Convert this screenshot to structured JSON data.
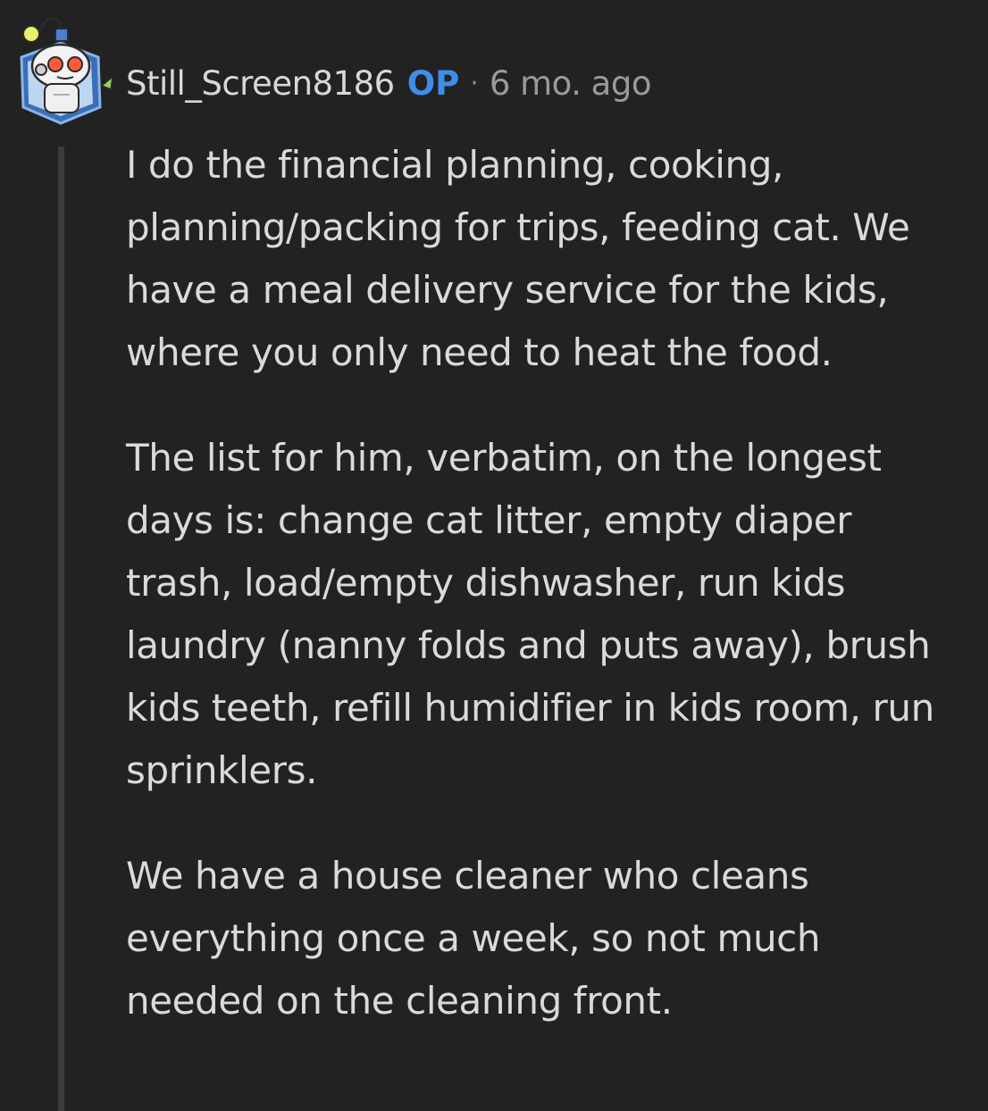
{
  "comment": {
    "author": {
      "username": "Still_Screen8186",
      "badge": "OP",
      "avatar_icon": "snoo-robot-avatar-icon"
    },
    "separator": "·",
    "timestamp": "6 mo. ago",
    "paragraphs": [
      "I do the financial planning, cooking, planning/packing for trips, feeding cat. We have a meal delivery service for the kids, where you only need to heat the food.",
      "The list for him, verbatim, on the longest days is: change cat litter, empty diaper trash, load/empty dishwasher, run kids laundry (nanny folds and puts away), brush kids teeth, refill humidifier in kids room, run sprinklers.",
      "We have a house cleaner who cleans everything once a week, so not much needed on the cleaning front."
    ]
  },
  "colors": {
    "background": "#222222",
    "op_badge": "#3e8ee8",
    "text": "#dadada",
    "muted": "#9a9a9a",
    "thread_line": "#3c3c3c"
  }
}
